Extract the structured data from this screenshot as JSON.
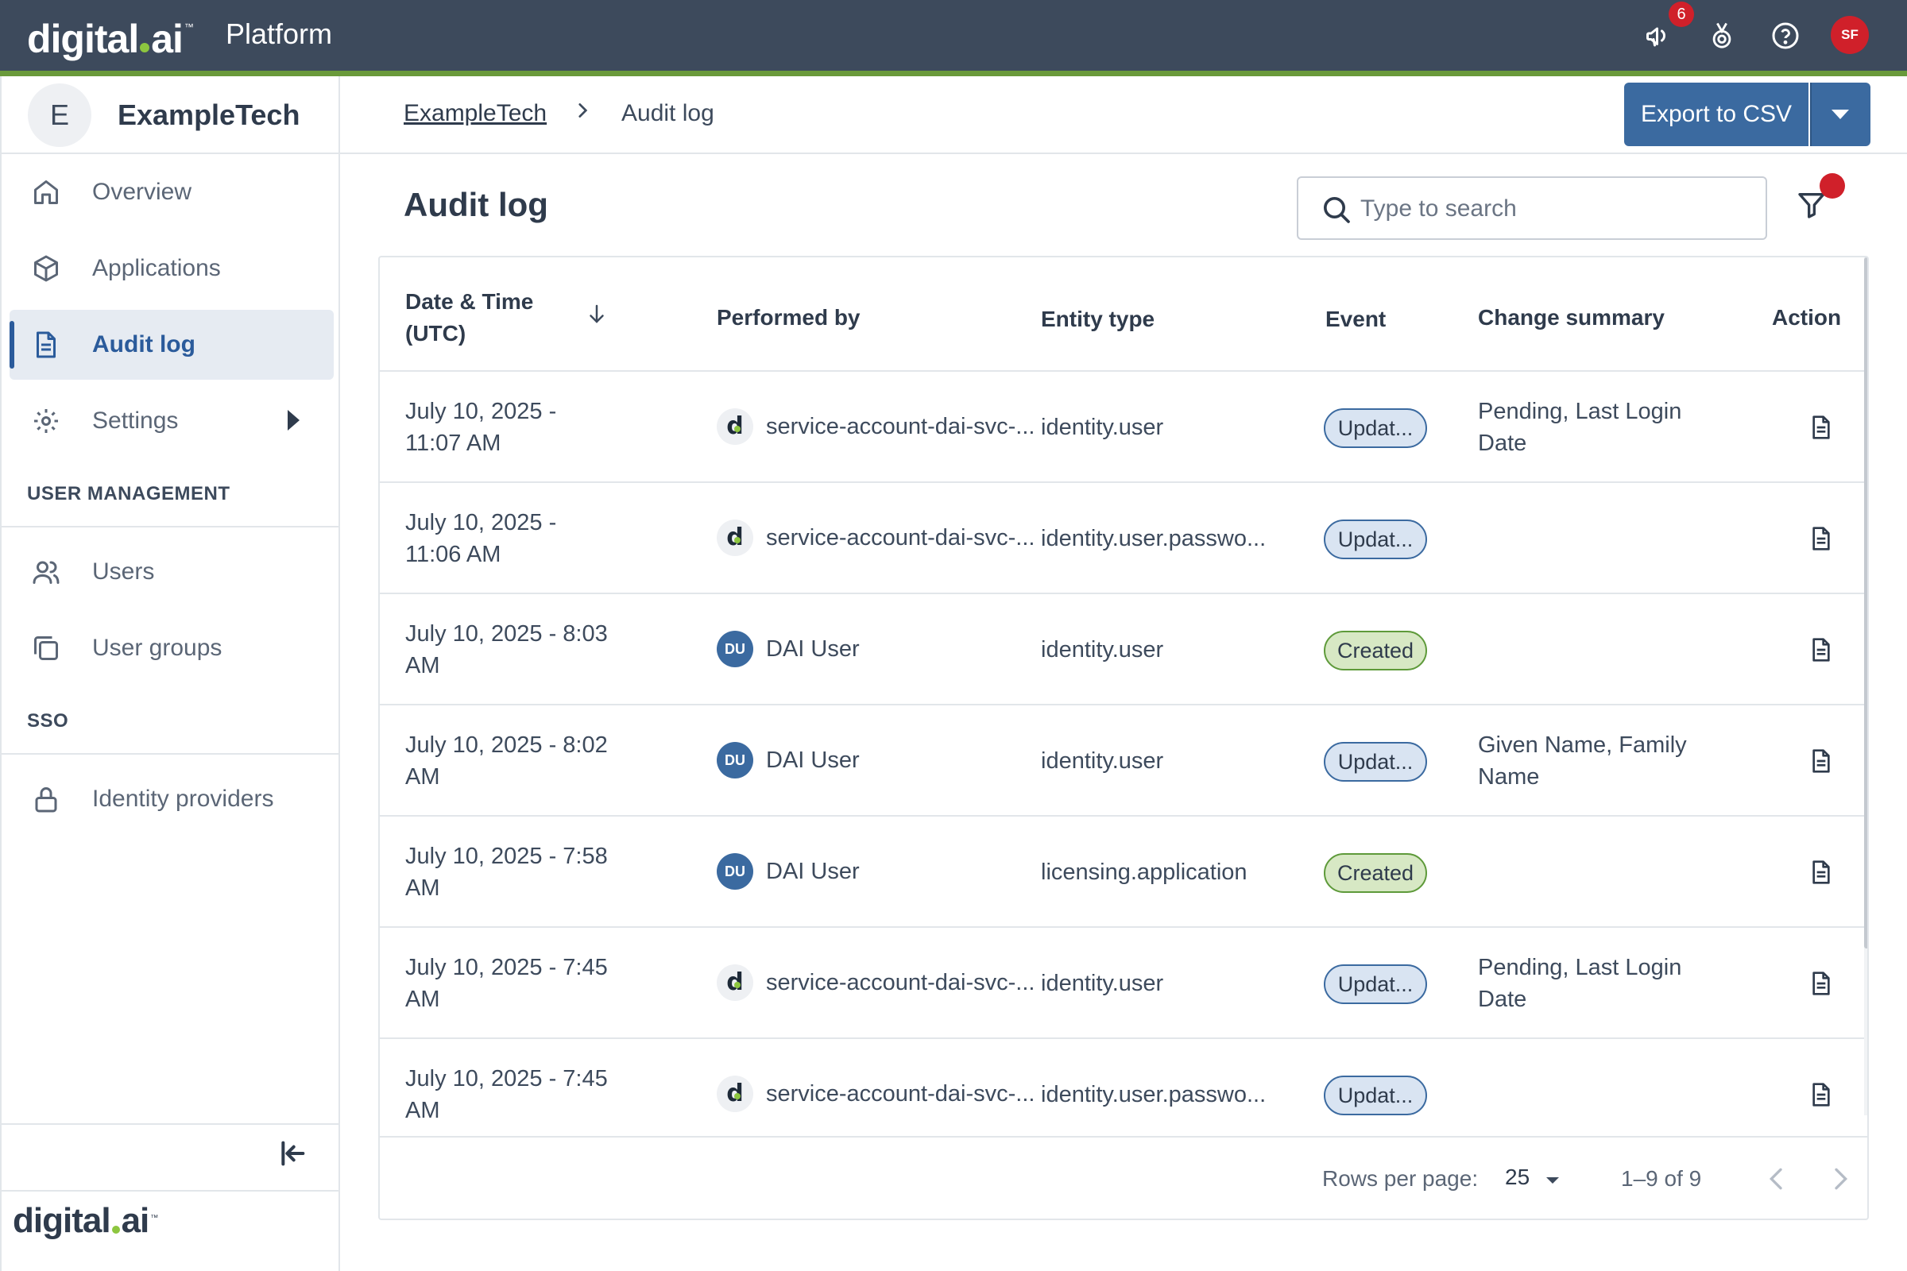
{
  "app": {
    "logo_text_1": "digital",
    "logo_text_2": "ai",
    "title": "Platform",
    "notifications_count": "6",
    "user_initials": "SF"
  },
  "sidebar": {
    "org_initial": "E",
    "org_name": "ExampleTech",
    "items": [
      {
        "label": "Overview",
        "icon": "home-icon"
      },
      {
        "label": "Applications",
        "icon": "cube-icon"
      },
      {
        "label": "Audit log",
        "icon": "document-icon",
        "active": true
      },
      {
        "label": "Settings",
        "icon": "gear-icon"
      }
    ],
    "sections": [
      {
        "title": "USER MANAGEMENT",
        "items": [
          {
            "label": "Users",
            "icon": "users-icon"
          },
          {
            "label": "User groups",
            "icon": "user-groups-icon"
          }
        ]
      },
      {
        "title": "SSO",
        "items": [
          {
            "label": "Identity providers",
            "icon": "lock-icon"
          }
        ]
      }
    ]
  },
  "breadcrumb": {
    "parent": "ExampleTech",
    "current": "Audit log"
  },
  "toolbar": {
    "export_label": "Export to CSV"
  },
  "page": {
    "title": "Audit log",
    "search_placeholder": "Type to search"
  },
  "table": {
    "columns": {
      "date_line1": "Date & Time",
      "date_line2": "(UTC)",
      "performed_by": "Performed by",
      "entity_type": "Entity type",
      "event": "Event",
      "change_summary": "Change summary",
      "action": "Action"
    },
    "rows": [
      {
        "date_1": "July 10, 2025 -",
        "date_2": "11:07 AM",
        "avatar": "logo",
        "avatar_text": "d",
        "user": "service-account-dai-svc-...",
        "entity": "identity.user",
        "event": "Updat...",
        "event_type": "updated",
        "summary_1": "Pending, Last Login",
        "summary_2": "Date"
      },
      {
        "date_1": "July 10, 2025 -",
        "date_2": "11:06 AM",
        "avatar": "logo",
        "avatar_text": "d",
        "user": "service-account-dai-svc-...",
        "entity": "identity.user.passwo...",
        "event": "Updat...",
        "event_type": "updated",
        "summary_1": "",
        "summary_2": ""
      },
      {
        "date_1": "July 10, 2025 - 8:03",
        "date_2": "AM",
        "avatar": "du",
        "avatar_text": "DU",
        "user": "DAI User",
        "entity": "identity.user",
        "event": "Created",
        "event_type": "created",
        "summary_1": "",
        "summary_2": ""
      },
      {
        "date_1": "July 10, 2025 - 8:02",
        "date_2": "AM",
        "avatar": "du",
        "avatar_text": "DU",
        "user": "DAI User",
        "entity": "identity.user",
        "event": "Updat...",
        "event_type": "updated",
        "summary_1": "Given Name, Family",
        "summary_2": "Name"
      },
      {
        "date_1": "July 10, 2025 - 7:58",
        "date_2": "AM",
        "avatar": "du",
        "avatar_text": "DU",
        "user": "DAI User",
        "entity": "licensing.application",
        "event": "Created",
        "event_type": "created",
        "summary_1": "",
        "summary_2": ""
      },
      {
        "date_1": "July 10, 2025 - 7:45",
        "date_2": "AM",
        "avatar": "logo",
        "avatar_text": "d",
        "user": "service-account-dai-svc-...",
        "entity": "identity.user",
        "event": "Updat...",
        "event_type": "updated",
        "summary_1": "Pending, Last Login",
        "summary_2": "Date"
      },
      {
        "date_1": "July 10, 2025 - 7:45",
        "date_2": "AM",
        "avatar": "logo",
        "avatar_text": "d",
        "user": "service-account-dai-svc-...",
        "entity": "identity.user.passwo...",
        "event": "Updat...",
        "event_type": "updated",
        "summary_1": "",
        "summary_2": ""
      }
    ]
  },
  "pagination": {
    "rows_per_page_label": "Rows per page:",
    "rows_per_page_value": "25",
    "range": "1–9 of 9"
  },
  "colors": {
    "topbar": "#3d4a5c",
    "accent_green": "#6a9a3b",
    "primary_blue": "#3b6aa0",
    "alert_red": "#d0202a"
  }
}
